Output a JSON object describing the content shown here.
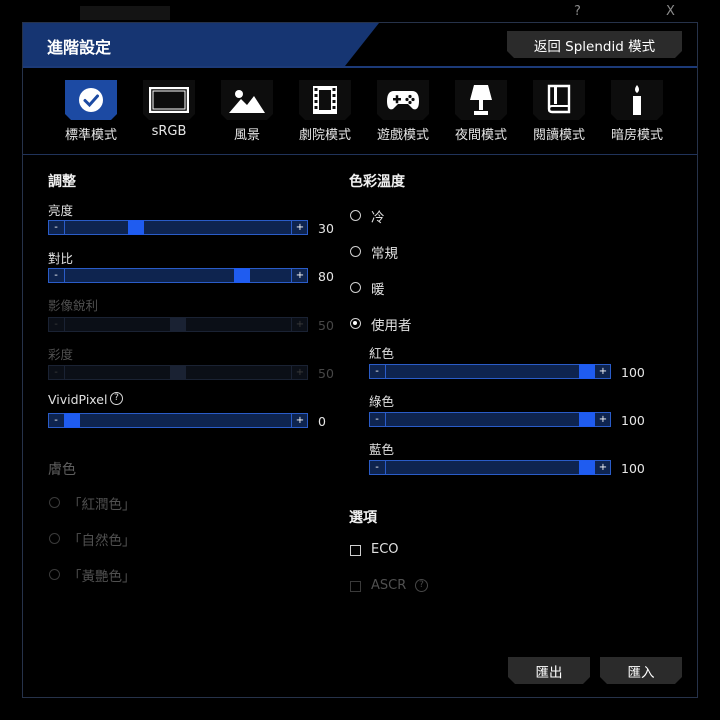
{
  "window": {
    "minimize": "?",
    "close": "X"
  },
  "header": {
    "title": "進階設定",
    "back_button": "返回 Splendid 模式"
  },
  "modes": [
    {
      "label": "標準模式",
      "icon": "check-icon",
      "active": true
    },
    {
      "label": "sRGB",
      "icon": "monitor-icon",
      "active": false
    },
    {
      "label": "風景",
      "icon": "landscape-icon",
      "active": false
    },
    {
      "label": "劇院模式",
      "icon": "film-icon",
      "active": false
    },
    {
      "label": "遊戲模式",
      "icon": "gamepad-icon",
      "active": false
    },
    {
      "label": "夜間模式",
      "icon": "lamp-icon",
      "active": false
    },
    {
      "label": "閱讀模式",
      "icon": "book-icon",
      "active": false
    },
    {
      "label": "暗房模式",
      "icon": "candle-icon",
      "active": false
    }
  ],
  "adjust": {
    "heading": "調整",
    "minus": "-",
    "plus": "+",
    "brightness": {
      "label": "亮度",
      "value": "30",
      "fraction": 0.3
    },
    "contrast": {
      "label": "對比",
      "value": "80",
      "fraction": 0.8
    },
    "sharpness": {
      "label": "影像銳利",
      "value": "50",
      "fraction": 0.5,
      "disabled": true
    },
    "saturation": {
      "label": "彩度",
      "value": "50",
      "fraction": 0.5,
      "disabled": true
    },
    "vividpixel": {
      "label": "VividPixel",
      "value": "0",
      "fraction": 0.0,
      "help": "?"
    }
  },
  "skin_tone": {
    "heading": "膚色",
    "options": [
      "「紅潤色」",
      "「自然色」",
      "「黃艷色」"
    ]
  },
  "color_temp": {
    "heading": "色彩溫度",
    "options": [
      "冷",
      "常規",
      "暖",
      "使用者"
    ],
    "selected": "使用者",
    "red": {
      "label": "紅色",
      "value": "100",
      "fraction": 1.0
    },
    "green": {
      "label": "綠色",
      "value": "100",
      "fraction": 1.0
    },
    "blue": {
      "label": "藍色",
      "value": "100",
      "fraction": 1.0
    }
  },
  "options": {
    "heading": "選項",
    "eco": "ECO",
    "ascr": "ASCR",
    "help": "?"
  },
  "footer": {
    "export": "匯出",
    "import": "匯入"
  },
  "colors": {
    "accent": "#1f5cf0",
    "banner": "#163572",
    "track": "#0e244f"
  }
}
